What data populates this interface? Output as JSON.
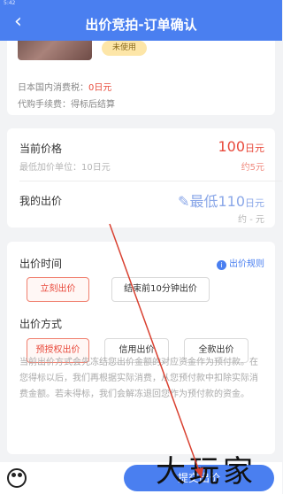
{
  "status_bar": {
    "time": "5:42"
  },
  "nav": {
    "title": "出价竞拍-订单确认",
    "back_icon": "back-arrow-icon"
  },
  "item": {
    "badge": "未使用",
    "tax_label": "日本国内消费税：",
    "tax_value": "0日元",
    "fee_label": "代购手续费：",
    "fee_value": "得标后结算"
  },
  "price": {
    "current_label": "当前价格",
    "current_value": "100",
    "current_unit": "日元",
    "current_approx": "约5元",
    "min_increment_label": "最低加价单位：10日元",
    "my_bid_label": "我的出价",
    "my_bid_value": "最低110",
    "my_bid_unit": "日元",
    "my_bid_approx": "约 - 元",
    "edit_icon": "pencil-icon"
  },
  "bid_time": {
    "title": "出价时间",
    "rule_link": "出价规则",
    "options": [
      "立刻出价",
      "结束前10分钟出价"
    ],
    "selected": "立刻出价"
  },
  "bid_method": {
    "title": "出价方式",
    "options": [
      "预授权出价",
      "信用出价",
      "全款出价"
    ],
    "selected": "预授权出价",
    "description": "当前出价方式会先冻结您出价金额的对应资金作为预付款。在您得标以后，我们再根据实际消费，从您预付款中扣除实际消费金额。若未得标，我们会解冻退回您作为预付款的资金。"
  },
  "bottom": {
    "submit_label": "提交出价",
    "watermark": "大玩家"
  },
  "colors": {
    "primary": "#4a7ff0",
    "price_red": "#e8483a",
    "badge_bg": "#fde6a8"
  }
}
